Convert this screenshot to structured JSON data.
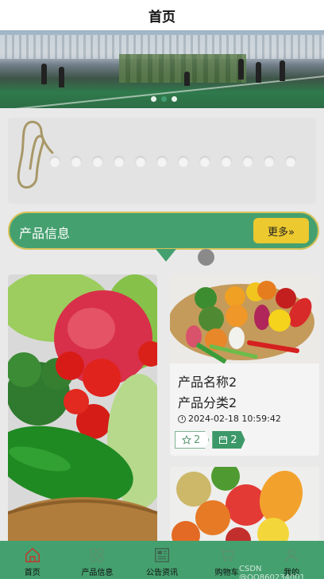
{
  "header": {
    "title": "首页"
  },
  "banner": {
    "slide_count": 3,
    "active_index": 1
  },
  "colors": {
    "primary": "#45a06f",
    "accent": "#ecc92f",
    "background": "#e9e9e9"
  },
  "section": {
    "title": "产品信息",
    "more_label": "更多»"
  },
  "products": [
    {
      "name": "产品名称2",
      "category": "产品分类2",
      "time": "2024-02-18 10:59:42",
      "favorites": "2",
      "comments": "2"
    }
  ],
  "tabbar": {
    "items": [
      {
        "label": "首页",
        "icon": "home-icon"
      },
      {
        "label": "产品信息",
        "icon": "grid-icon"
      },
      {
        "label": "公告资讯",
        "icon": "news-icon"
      },
      {
        "label": "购物车",
        "icon": "cart-icon"
      },
      {
        "label": "我的",
        "icon": "user-icon"
      }
    ]
  },
  "watermark": "CSDN @QQ860234001"
}
